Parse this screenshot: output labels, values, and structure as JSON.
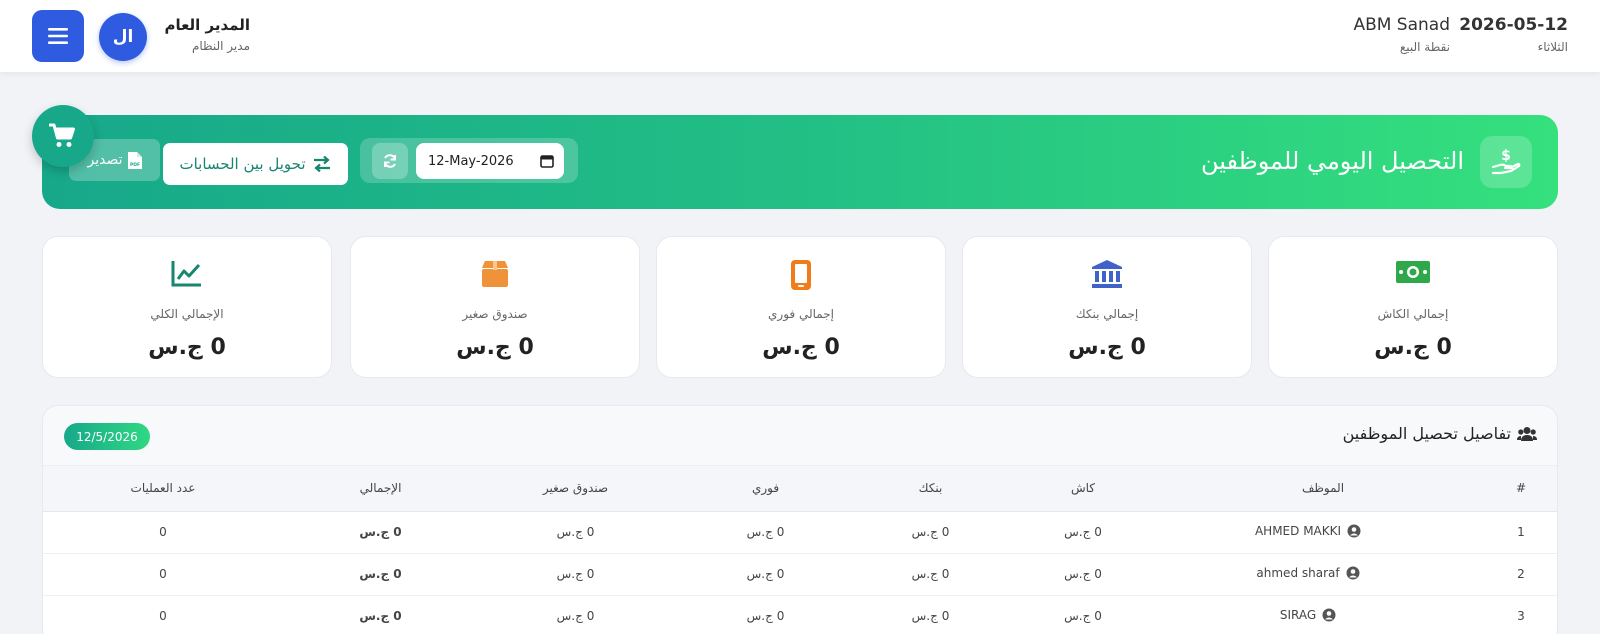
{
  "header": {
    "user_name": "المدير العام",
    "user_role": "مدير النظام",
    "avatar_initials": "ال",
    "branch_name": "ABM Sanad",
    "branch_sub": "نقطة البيع",
    "date": "2026-05-12",
    "day": "الثلاثاء"
  },
  "banner": {
    "title": "التحصيل اليومي للموظفين",
    "date_value": "12-May-2026",
    "transfer_label": "تحويل بين الحسابات",
    "export_label": "تصدير"
  },
  "cards": [
    {
      "label": "إجمالي الكاش",
      "value": "0 ج.س",
      "icon": "money-bill-icon",
      "color": "#2ea84a"
    },
    {
      "label": "إجمالي بنكك",
      "value": "0 ج.س",
      "icon": "bank-icon",
      "color": "#3f63c9"
    },
    {
      "label": "إجمالي فوري",
      "value": "0 ج.س",
      "icon": "mobile-icon",
      "color": "#f07c1a"
    },
    {
      "label": "صندوق صغير",
      "value": "0 ج.س",
      "icon": "box-icon",
      "color": "#f0923a"
    },
    {
      "label": "الإجمالي الكلي",
      "value": "0 ج.س",
      "icon": "chart-line-icon",
      "color": "#17866f"
    }
  ],
  "details": {
    "title": "تفاصيل تحصيل الموظفين",
    "date_badge": "12/5/2026",
    "columns": [
      "#",
      "الموظف",
      "كاش",
      "بنكك",
      "فوري",
      "صندوق صغير",
      "الإجمالي",
      "عدد العمليات"
    ],
    "rows": [
      {
        "idx": "1",
        "employee": "AHMED MAKKI",
        "cash": "0 ج.س",
        "bank": "0 ج.س",
        "fawry": "0 ج.س",
        "box": "0 ج.س",
        "total": "0 ج.س",
        "ops": "0"
      },
      {
        "idx": "2",
        "employee": "ahmed sharaf",
        "cash": "0 ج.س",
        "bank": "0 ج.س",
        "fawry": "0 ج.س",
        "box": "0 ج.س",
        "total": "0 ج.س",
        "ops": "0"
      },
      {
        "idx": "3",
        "employee": "SIRAG",
        "cash": "0 ج.س",
        "bank": "0 ج.س",
        "fawry": "0 ج.س",
        "box": "0 ج.س",
        "total": "0 ج.س",
        "ops": "0"
      }
    ]
  },
  "colors": {
    "primary": "#2f5be0",
    "accent_green": "#17a88a",
    "cash": "#2ea84a",
    "bank": "#3f63c9",
    "fawry": "#e07a1f",
    "box": "#e8922e"
  }
}
